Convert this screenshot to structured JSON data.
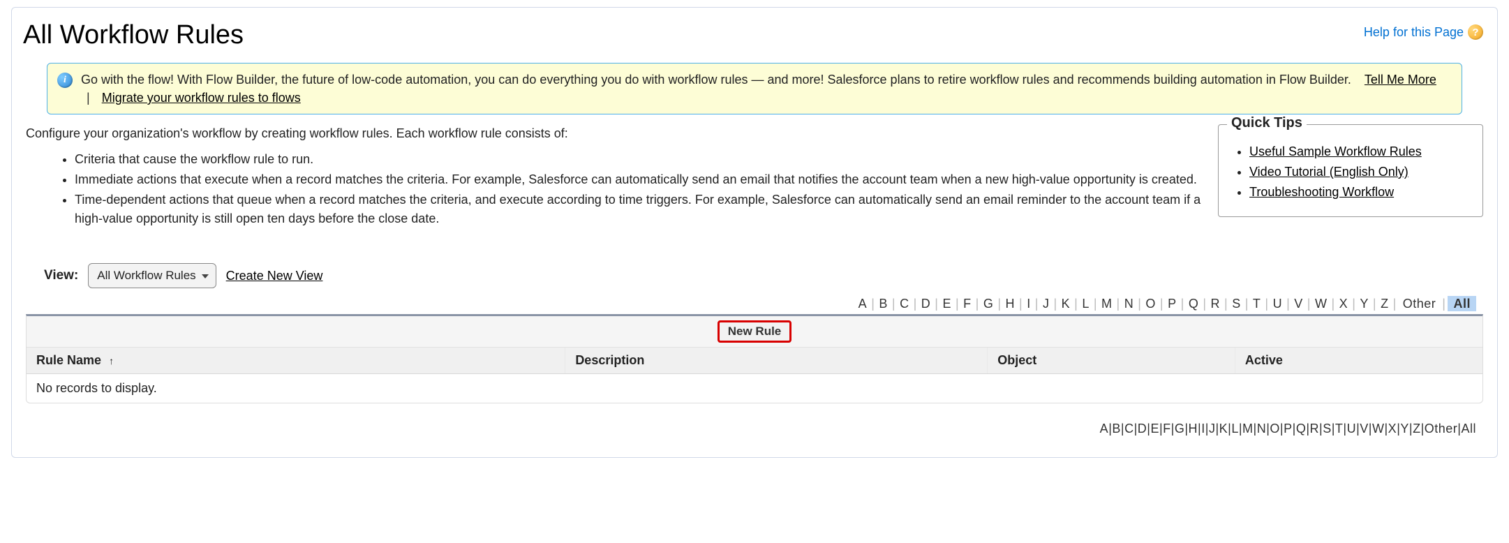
{
  "page": {
    "title": "All Workflow Rules",
    "help_label": "Help for this Page"
  },
  "banner": {
    "text": "Go with the flow! With Flow Builder, the future of low-code automation, you can do everything you do with workflow rules — and more! Salesforce plans to retire workflow rules and recommends building automation in Flow Builder.",
    "tell_me_more": "Tell Me More",
    "migrate": "Migrate your workflow rules to flows"
  },
  "intro": {
    "text": "Configure your organization's workflow by creating workflow rules. Each workflow rule consists of:",
    "items": [
      "Criteria that cause the workflow rule to run.",
      "Immediate actions that execute when a record matches the criteria. For example, Salesforce can automatically send an email that notifies the account team when a new high-value opportunity is created.",
      "Time-dependent actions that queue when a record matches the criteria, and execute according to time triggers. For example, Salesforce can automatically send an email reminder to the account team if a high-value opportunity is still open ten days before the close date."
    ]
  },
  "quick_tips": {
    "title": "Quick Tips",
    "items": [
      "Useful Sample Workflow Rules",
      "Video Tutorial (English Only)",
      "Troubleshooting Workflow"
    ]
  },
  "view": {
    "label": "View:",
    "selected": "All Workflow Rules",
    "create_new": "Create New View"
  },
  "alpha": {
    "letters": [
      "A",
      "B",
      "C",
      "D",
      "E",
      "F",
      "G",
      "H",
      "I",
      "J",
      "K",
      "L",
      "M",
      "N",
      "O",
      "P",
      "Q",
      "R",
      "S",
      "T",
      "U",
      "V",
      "W",
      "X",
      "Y",
      "Z"
    ],
    "other": "Other",
    "all": "All"
  },
  "table": {
    "new_rule_button": "New Rule",
    "columns": {
      "rule_name": "Rule Name",
      "description": "Description",
      "object": "Object",
      "active": "Active"
    },
    "empty": "No records to display."
  }
}
